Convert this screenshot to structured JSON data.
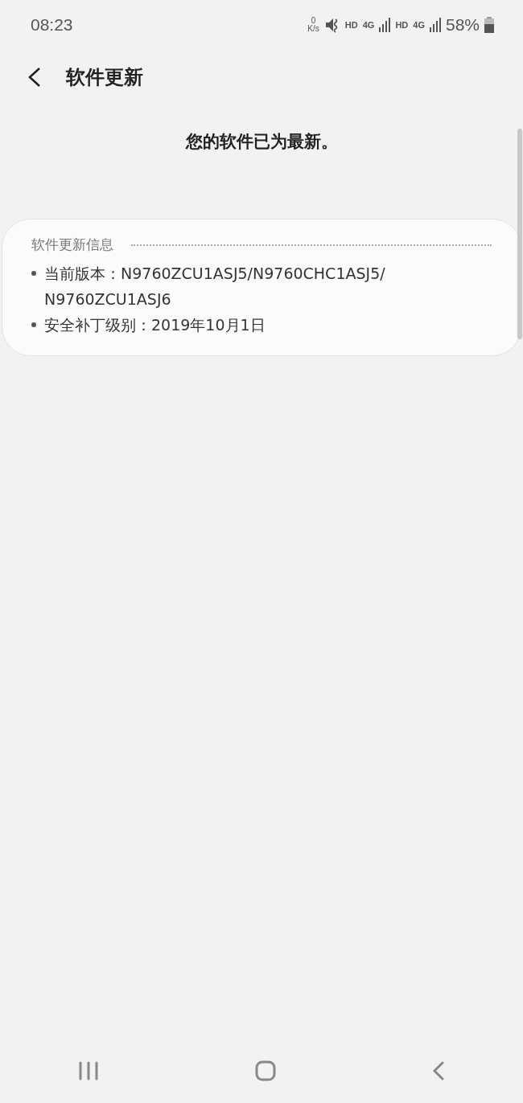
{
  "status_bar": {
    "time": "08:23",
    "speed_value": "0",
    "speed_unit": "K/s",
    "hd_1": "HD",
    "network_1": "4G",
    "hd_2": "HD",
    "network_2": "4G",
    "battery": "58%"
  },
  "app_bar": {
    "title": "软件更新"
  },
  "message": "您的软件已为最新。",
  "info_card": {
    "heading": "软件更新信息",
    "items": [
      {
        "label": "当前版本：",
        "value": "N9760ZCU1ASJ5/N9760CHC1ASJ5/ N9760ZCU1ASJ6"
      },
      {
        "label": "安全补丁级别：",
        "value": "2019年10月1日"
      }
    ]
  }
}
